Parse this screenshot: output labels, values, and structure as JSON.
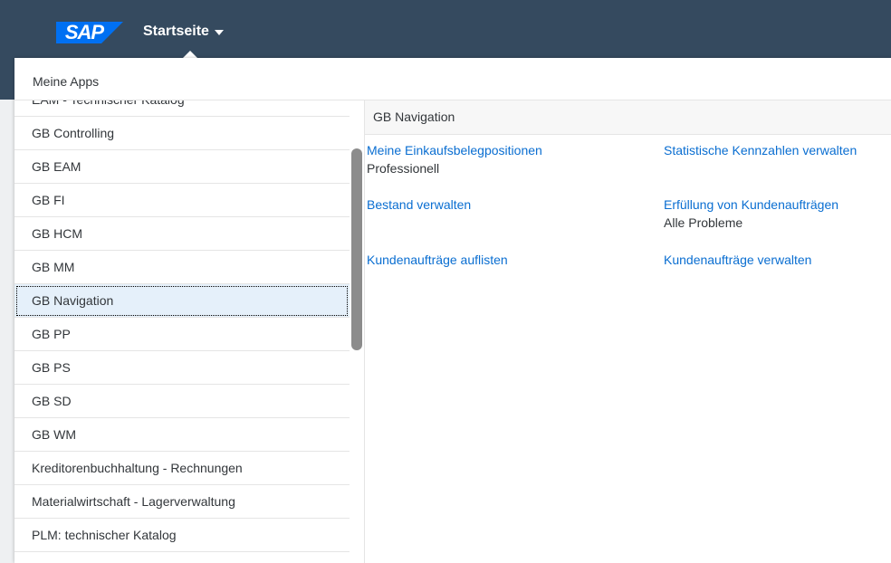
{
  "header": {
    "logo_text": "SAP",
    "title": "Startseite",
    "colors": {
      "shell": "#354a5f",
      "logo": "#0070f2",
      "link": "#0a6ed1"
    }
  },
  "popover": {
    "title": "Meine Apps"
  },
  "catalogs": [
    {
      "label": "EAM - Technischer Katalog"
    },
    {
      "label": "GB Controlling"
    },
    {
      "label": "GB EAM"
    },
    {
      "label": "GB FI"
    },
    {
      "label": "GB HCM"
    },
    {
      "label": "GB MM"
    },
    {
      "label": "GB Navigation",
      "selected": true
    },
    {
      "label": "GB PP"
    },
    {
      "label": "GB PS"
    },
    {
      "label": "GB SD"
    },
    {
      "label": "GB WM"
    },
    {
      "label": "Kreditorenbuchhaltung - Rechnungen"
    },
    {
      "label": "Materialwirtschaft - Lagerverwaltung"
    },
    {
      "label": "PLM: technischer Katalog"
    }
  ],
  "group": {
    "title": "GB Navigation",
    "apps": [
      {
        "title": "Meine Einkaufsbelegpositionen",
        "subtitle": "Professionell"
      },
      {
        "title": "Statistische Kennzahlen verwalten",
        "subtitle": ""
      },
      {
        "title": "Bestand verwalten",
        "subtitle": ""
      },
      {
        "title": "Erfüllung von Kundenaufträgen",
        "subtitle": "Alle Probleme"
      },
      {
        "title": "Kundenaufträge auflisten",
        "subtitle": ""
      },
      {
        "title": "Kundenaufträge verwalten",
        "subtitle": ""
      }
    ]
  }
}
